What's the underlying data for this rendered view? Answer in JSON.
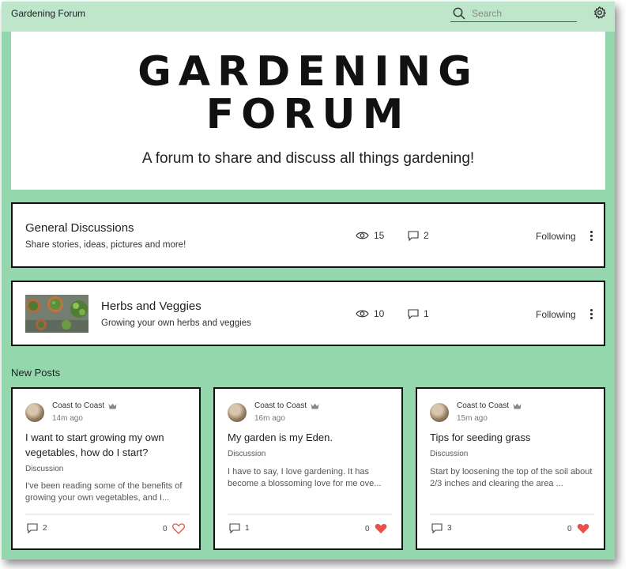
{
  "header": {
    "site_name": "Gardening Forum",
    "search_placeholder": "Search"
  },
  "hero": {
    "title_line1": "GARDENING",
    "title_line2": "FORUM",
    "subtitle": "A forum to share and discuss all things gardening!"
  },
  "categories": [
    {
      "title": "General Discussions",
      "description": "Share stories, ideas, pictures and more!",
      "views": "15",
      "posts": "2",
      "follow_label": "Following"
    },
    {
      "title": "Herbs and Veggies",
      "description": "Growing your own herbs and veggies",
      "views": "10",
      "posts": "1",
      "follow_label": "Following"
    }
  ],
  "new_posts_label": "New Posts",
  "posts": [
    {
      "author": "Coast to Coast",
      "time": "14m ago",
      "title": "I want to start growing my own vegetables, how do I start?",
      "category": "Discussion",
      "excerpt": "I've been reading some of the benefits of growing your own vegetables, and I...",
      "comments": "2",
      "likes": "0",
      "liked": false
    },
    {
      "author": "Coast to Coast",
      "time": "16m ago",
      "title": "My garden is my Eden.",
      "category": "Discussion",
      "excerpt": "I have to say, I love gardening. It has become a blossoming love for me ove...",
      "comments": "1",
      "likes": "0",
      "liked": true
    },
    {
      "author": "Coast to Coast",
      "time": "15m ago",
      "title": "Tips for seeding grass",
      "category": "Discussion",
      "excerpt": "Start by loosening the top of the soil about 2/3 inches and clearing the area ...",
      "comments": "3",
      "likes": "0",
      "liked": true
    }
  ],
  "colors": {
    "page_green": "#95d7ad",
    "topbar_green": "#bde6cb",
    "heart_red": "#e8504a"
  }
}
